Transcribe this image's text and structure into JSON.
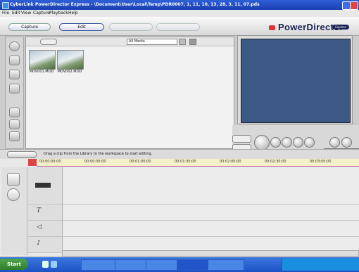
{
  "window": {
    "title": "CyberLink PowerDirector Express - \\Document\\User\\Local\\Temp\\PDR0007, 1, 11, 10, 13, 28, 3, 11, 07.pds"
  },
  "menu": {
    "items": [
      "File",
      "Edit",
      "View",
      "Capture",
      "Playback",
      "Help"
    ]
  },
  "modes": {
    "capture": "Capture",
    "edit": "Edit"
  },
  "brand": {
    "name": "PowerDirector",
    "badge": "Express"
  },
  "library": {
    "filter_label": "All Media",
    "files": [
      {
        "name": "MOV001.MOD"
      },
      {
        "name": "MOV002.MOD"
      }
    ],
    "hint": "Drag a clip from the Library to the workspace to start editing."
  },
  "timeline": {
    "ruler": [
      "00:00:00:00",
      "00:00:30;00",
      "00:01:00;00",
      "00:01:30;00",
      "00:02:00;00",
      "00:02:30;00",
      "00:03:00;00"
    ]
  },
  "taskbar": {
    "start": "Start"
  },
  "colors": {
    "accent": "#1b2455",
    "titlebar": "#2f5fd6",
    "preview": "#3d5a86",
    "taskbar": "#1d52c4"
  }
}
